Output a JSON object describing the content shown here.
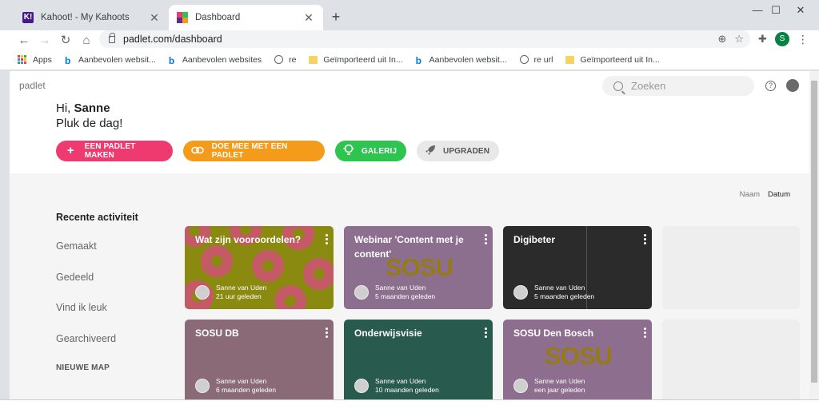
{
  "browser": {
    "tabs": [
      {
        "title": "Kahoot! - My Kahoots",
        "favicon_text": "K!",
        "active": false
      },
      {
        "title": "Dashboard",
        "active": true
      }
    ],
    "url": "padlet.com/dashboard",
    "profile_initial": "S",
    "bookmarks": [
      {
        "label": "Apps",
        "icon": "apps-grid-icon"
      },
      {
        "label": "Aanbevolen websit...",
        "icon": "bing-icon"
      },
      {
        "label": "Aanbevolen websites",
        "icon": "bing-icon"
      },
      {
        "label": "re",
        "icon": "globe-icon"
      },
      {
        "label": "Geïmporteerd uit In...",
        "icon": "folder-icon"
      },
      {
        "label": "Aanbevolen websit...",
        "icon": "bing-icon"
      },
      {
        "label": "re url",
        "icon": "globe-icon"
      },
      {
        "label": "Geïmporteerd uit In...",
        "icon": "folder-icon"
      }
    ]
  },
  "header": {
    "logo": "padlet",
    "search_placeholder": "Zoeken"
  },
  "greeting": {
    "hi": "Hi,",
    "name": "Sanne",
    "subtitle": "Pluk de dag!"
  },
  "actions": [
    {
      "label": "EEN PADLET MAKEN",
      "icon": "plus-icon",
      "color": "#ef3a6f"
    },
    {
      "label": "DOE MEE MET EEN PADLET",
      "icon": "link-icon",
      "color": "#f59b1b"
    },
    {
      "label": "GALERIJ",
      "icon": "lightbulb-icon",
      "color": "#2dc450"
    },
    {
      "label": "UPGRADEN",
      "icon": "rocket-icon",
      "color": "#e8e8e8"
    }
  ],
  "sort": {
    "options": [
      "Naam",
      "Datum"
    ],
    "selected": "Datum"
  },
  "sidenav": {
    "heading": "Recente activiteit",
    "items": [
      "Gemaakt",
      "Gedeeld",
      "Vind ik leuk",
      "Gearchiveerd"
    ],
    "new_folder": "NIEUWE MAP"
  },
  "padlets": [
    {
      "title": "Wat zijn vooroordelen?",
      "author": "Sanne van Uden",
      "time": "21 uur geleden",
      "color": "#8a8a11"
    },
    {
      "title": "Webinar 'Content met je content'",
      "author": "Sanne van Uden",
      "time": "5 maanden geleden",
      "color": "#8c6f8f"
    },
    {
      "title": "Digibeter",
      "author": "Sanne van Uden",
      "time": "5 maanden geleden",
      "color": "#2b2b2b"
    },
    {
      "title": "SOSU DB",
      "author": "Sanne van Uden",
      "time": "6 maanden geleden",
      "color": "#8b6a78"
    },
    {
      "title": "Onderwijsvisie",
      "author": "Sanne van Uden",
      "time": "10 maanden geleden",
      "color": "#285a4d"
    },
    {
      "title": "SOSU Den Bosch",
      "author": "Sanne van Uden",
      "time": "een jaar geleden",
      "color": "#8d6e8f"
    }
  ]
}
